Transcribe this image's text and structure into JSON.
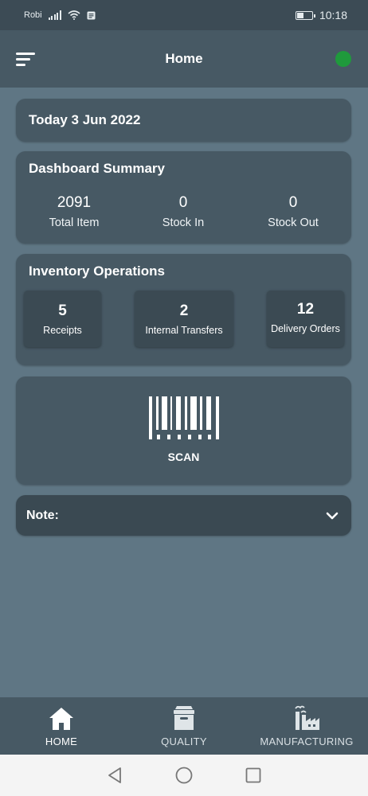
{
  "status_bar": {
    "carrier": "Robi",
    "time": "10:18",
    "battery_level": 0.4
  },
  "app_bar": {
    "title": "Home",
    "menu_icon": "sort-menu-icon",
    "status_color": "#1f9a3c"
  },
  "date_card": {
    "text": "Today 3 Jun 2022"
  },
  "dashboard": {
    "title": "Dashboard Summary",
    "stats": [
      {
        "value": "2091",
        "label": "Total Item"
      },
      {
        "value": "0",
        "label": "Stock In"
      },
      {
        "value": "0",
        "label": "Stock Out"
      }
    ]
  },
  "inventory": {
    "title": "Inventory Operations",
    "operations": [
      {
        "count": "5",
        "label": "Receipts"
      },
      {
        "count": "2",
        "label": "Internal Transfers"
      },
      {
        "count": "12",
        "label": "Delivery Orders"
      }
    ]
  },
  "scan": {
    "label": "SCAN",
    "icon": "barcode-icon"
  },
  "note": {
    "label": "Note:",
    "icon": "chevron-down-icon"
  },
  "bottom_nav": {
    "items": [
      {
        "label": "HOME",
        "icon": "home-icon",
        "active": true
      },
      {
        "label": "QUALITY",
        "icon": "archive-box-icon",
        "active": false
      },
      {
        "label": "MANUFACTURING",
        "icon": "factory-icon",
        "active": false
      }
    ]
  },
  "colors": {
    "background": "#5f7684",
    "card": "#475964",
    "accent_online": "#1f9a3c"
  }
}
